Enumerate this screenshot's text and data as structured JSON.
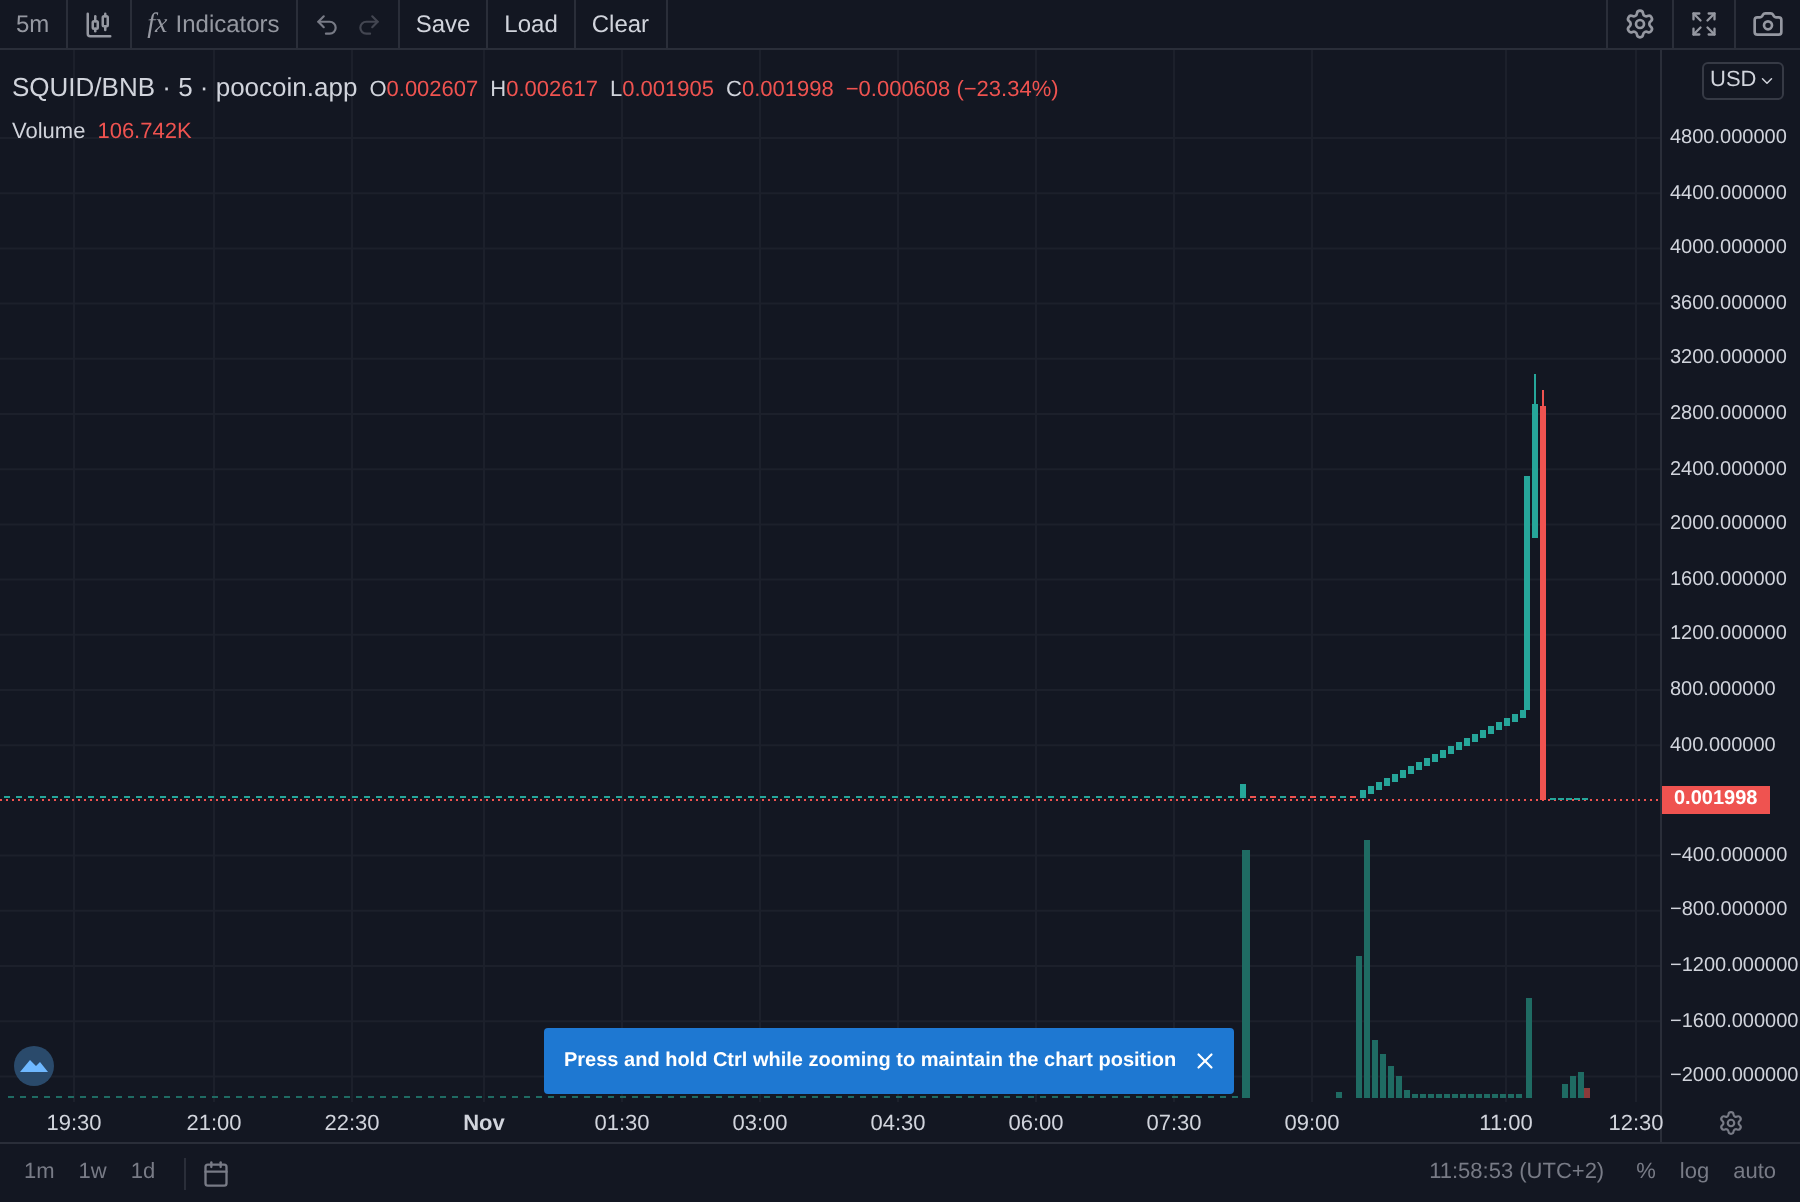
{
  "toolbar": {
    "interval": "5m",
    "indicators_icon": "fx",
    "indicators_label": "Indicators",
    "history": [
      {
        "kind": "undo",
        "disabled": false
      },
      {
        "kind": "redo",
        "disabled": true
      }
    ],
    "buttons": [
      "Save",
      "Load",
      "Clear"
    ]
  },
  "legend": {
    "title": "SQUID/BNB · 5 · poocoin.app",
    "ohlc": [
      {
        "label": "O",
        "value": "0.002607"
      },
      {
        "label": "H",
        "value": "0.002617"
      },
      {
        "label": "L",
        "value": "0.001905"
      },
      {
        "label": "C",
        "value": "0.001998"
      }
    ],
    "change": "−0.000608 (−23.34%)",
    "volume_label": "Volume",
    "volume_value": "106.742K"
  },
  "price_axis": {
    "currency": "USD",
    "ticks": [
      "4800.000000",
      "4400.000000",
      "4000.000000",
      "3600.000000",
      "3200.000000",
      "2800.000000",
      "2400.000000",
      "2000.000000",
      "1600.000000",
      "1200.000000",
      "800.000000",
      "400.000000",
      "−400.000000",
      "−800.000000",
      "−1200.000000",
      "−1600.000000",
      "−2000.000000"
    ],
    "last_price": "0.001998"
  },
  "time_axis": {
    "ticks": [
      {
        "label": "19:30",
        "bold": false
      },
      {
        "label": "21:00",
        "bold": false
      },
      {
        "label": "22:30",
        "bold": false
      },
      {
        "label": "Nov",
        "bold": true
      },
      {
        "label": "01:30",
        "bold": false
      },
      {
        "label": "03:00",
        "bold": false
      },
      {
        "label": "04:30",
        "bold": false
      },
      {
        "label": "06:00",
        "bold": false
      },
      {
        "label": "07:30",
        "bold": false
      },
      {
        "label": "09:00",
        "bold": false
      },
      {
        "label": "11:00",
        "bold": false
      },
      {
        "label": "12:30",
        "bold": false
      }
    ]
  },
  "toast": {
    "message": "Press and hold Ctrl while zooming to maintain the chart position"
  },
  "bottom_bar": {
    "ranges": [
      "1m",
      "1w",
      "1d"
    ],
    "time": "11:58:53 (UTC+2)",
    "options": [
      "%",
      "log",
      "auto"
    ]
  }
}
